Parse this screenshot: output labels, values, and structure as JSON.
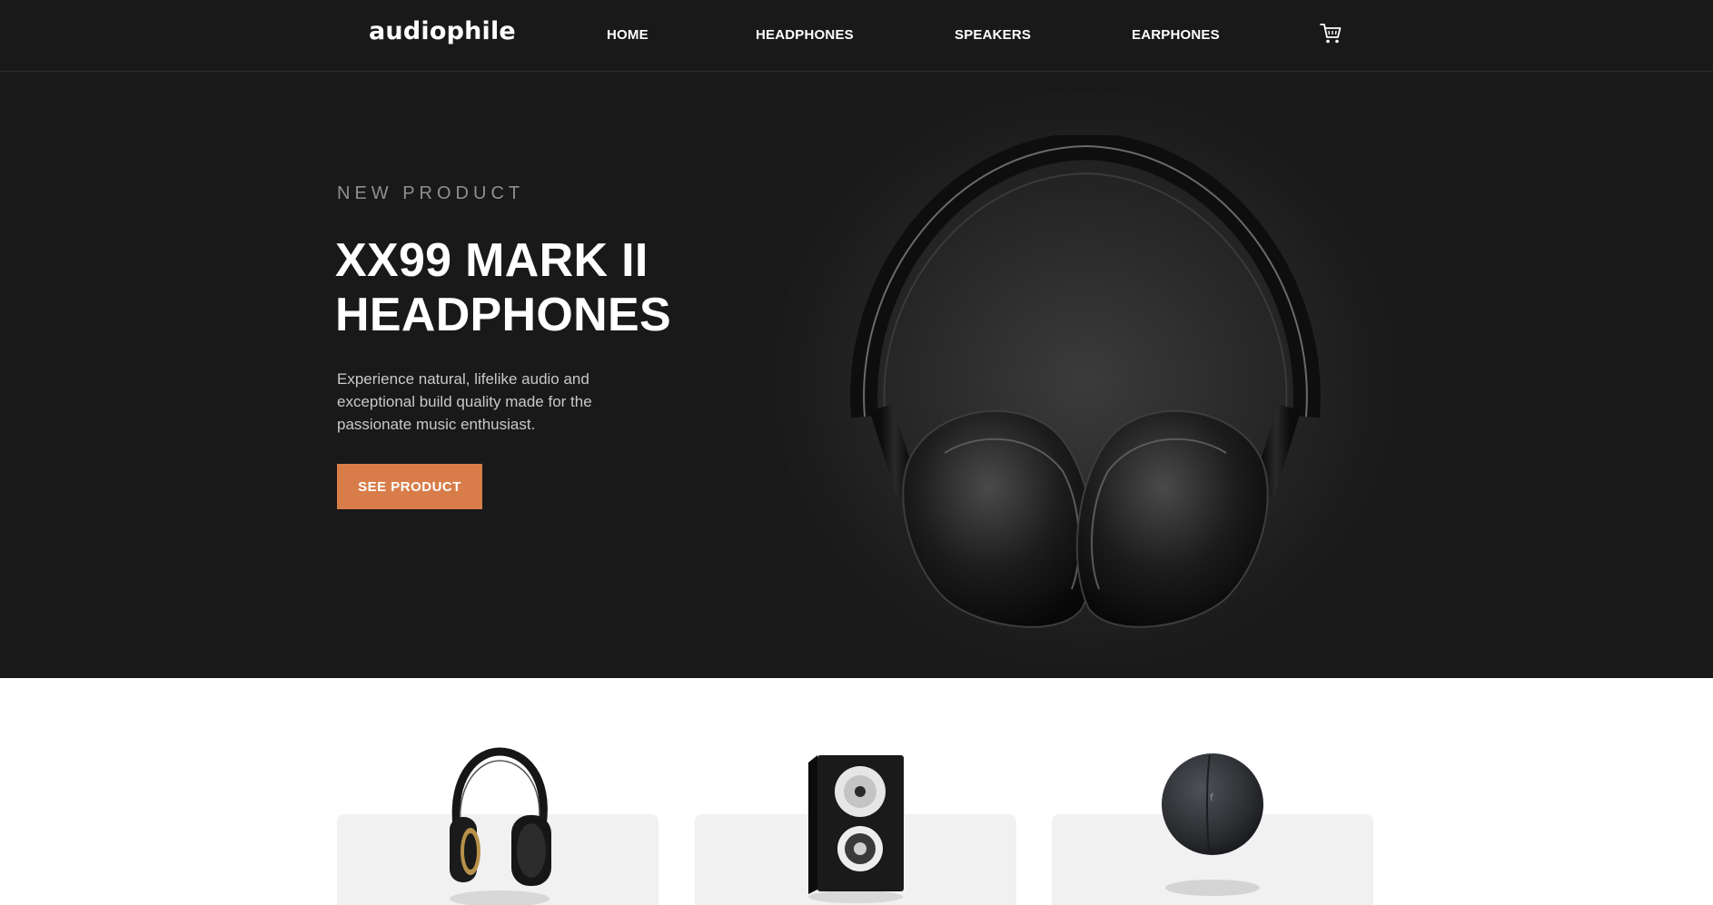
{
  "header": {
    "logo": "audiophile",
    "nav": [
      {
        "label": "HOME"
      },
      {
        "label": "HEADPHONES"
      },
      {
        "label": "SPEAKERS"
      },
      {
        "label": "EARPHONES"
      }
    ],
    "cart_icon": "cart-icon"
  },
  "hero": {
    "overline": "NEW PRODUCT",
    "title": "XX99 MARK II HEADPHONES",
    "description": "Experience natural, lifelike audio and exceptional build quality made for the passionate music enthusiast.",
    "cta_label": "SEE PRODUCT",
    "image_icon": "headphones-image"
  },
  "categories": [
    {
      "image_icon": "headphones-image"
    },
    {
      "image_icon": "speaker-image"
    },
    {
      "image_icon": "earphones-case-image"
    }
  ],
  "colors": {
    "dark_bg": "#191919",
    "accent": "#d87d4a",
    "card_bg": "#f1f1f1",
    "overline": "#8f8f8f"
  }
}
